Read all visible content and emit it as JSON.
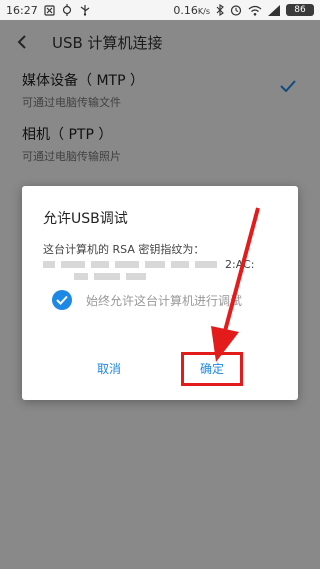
{
  "status_bar": {
    "time": "16:27",
    "speed": "0.16",
    "speed_unit": "K/s",
    "battery": "86",
    "icons": [
      "sim-card-icon",
      "usb-debug-icon",
      "usb-icon",
      "bluetooth-icon",
      "alarm-icon",
      "wifi-icon",
      "signal-icon",
      "battery-icon"
    ]
  },
  "header": {
    "title": "USB 计算机连接"
  },
  "list": {
    "items": [
      {
        "title": "媒体设备（ MTP ）",
        "subtitle": "可通过电脑传输文件",
        "checked": true
      },
      {
        "title": "相机（ PTP ）",
        "subtitle": "可通过电脑传输照片",
        "checked": false
      }
    ]
  },
  "dialog": {
    "title": "允许USB调试",
    "fingerprint_label": "这台计算机的 RSA 密钥指纹为：",
    "fingerprint_visible_tail": "2:AC:",
    "always_allow_label": "始终允许这台计算机进行调试",
    "always_allow_checked": true,
    "cancel_label": "取消",
    "ok_label": "确定"
  },
  "colors": {
    "accent": "#1e88e5",
    "highlight": "#e31b1b"
  }
}
